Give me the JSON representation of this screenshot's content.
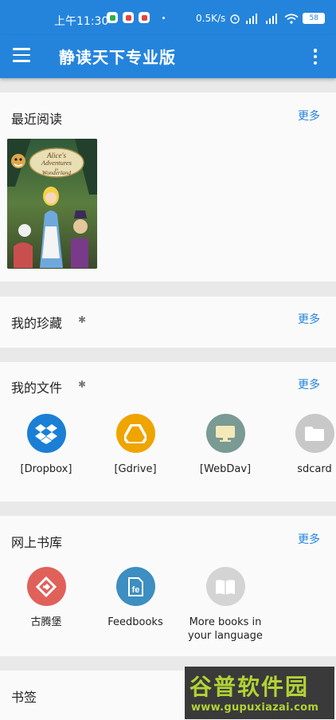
{
  "status_bar": {
    "time": "上午11:30",
    "net_speed": "0.5K/s",
    "battery": "58",
    "app_icon_colors": [
      "#2bb24c",
      "#e2463b",
      "#e2463b"
    ]
  },
  "app_bar": {
    "title": "静读天下专业版"
  },
  "sections": {
    "recent": {
      "title": "最近阅读",
      "more": "更多"
    },
    "favorites": {
      "title": "我的珍藏",
      "more": "更多"
    },
    "files": {
      "title": "我的文件",
      "more": "更多",
      "items": [
        {
          "label": "[Dropbox]",
          "icon": "dropbox-icon",
          "color": "#1b7fd6"
        },
        {
          "label": "[Gdrive]",
          "icon": "gdrive-icon",
          "color": "#efa400"
        },
        {
          "label": "[WebDav]",
          "icon": "webdav-icon",
          "color": "#7a9a94"
        },
        {
          "label": "sdcard",
          "icon": "folder-icon",
          "color": "#c8c8c8"
        }
      ]
    },
    "library": {
      "title": "网上书库",
      "more": "更多",
      "items": [
        {
          "label": "古腾堡",
          "icon": "gutenberg-icon",
          "color": "#e0615a"
        },
        {
          "label": "Feedbooks",
          "icon": "feedbooks-icon",
          "color": "#3d8ec1"
        },
        {
          "label": "More books in your language",
          "icon": "book-icon",
          "color": "#d4d4d4"
        }
      ]
    },
    "bookmarks": {
      "title": "书签"
    }
  },
  "book_cover": {
    "title_line1": "Alice's",
    "title_line2": "Adventures",
    "title_line3": "in",
    "title_line4": "Wonderland"
  },
  "watermark": {
    "brand": "谷普软件园",
    "url": "www.gupuxiazai.com"
  }
}
